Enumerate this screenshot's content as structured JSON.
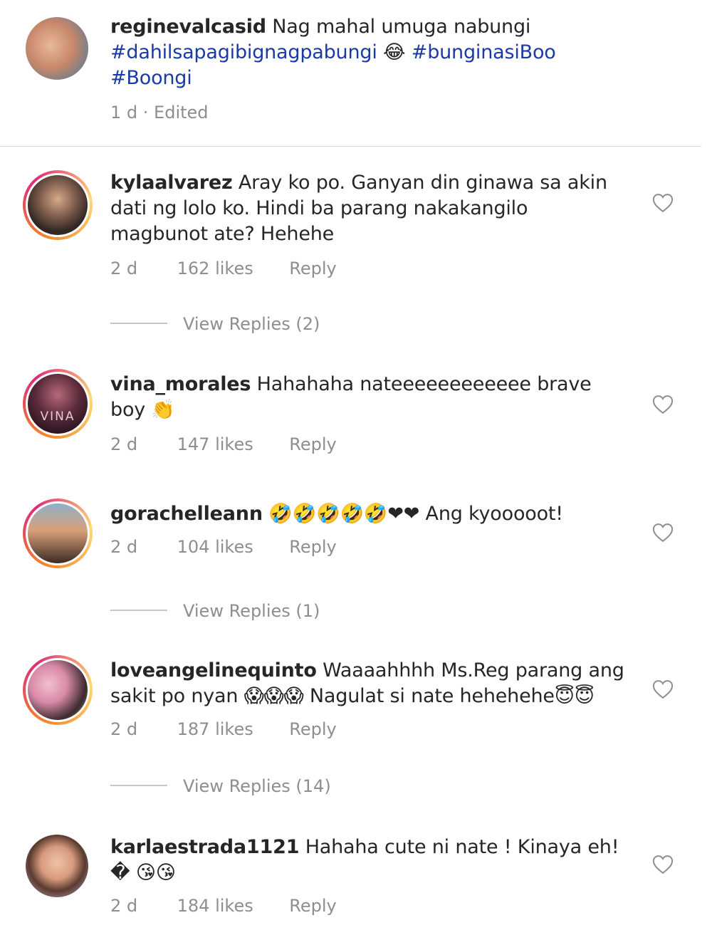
{
  "caption": {
    "username": "reginevalcasid",
    "text": "Nag mahal umuga nabungi",
    "hashtags": [
      "#dahilsapagibignagpabungi",
      "#bunginasiBoo",
      "#Boongi"
    ],
    "emoji": "😂",
    "time": "1 d",
    "edited": "· Edited"
  },
  "comments": [
    {
      "username": "kylaalvarez",
      "text": "Aray ko po. Ganyan din ginawa sa akin dati ng lolo ko. Hindi ba parang nakakangilo magbunot ate? Hehehe",
      "time": "2 d",
      "likes": "162 likes",
      "reply": "Reply",
      "view_replies": "View Replies (2)"
    },
    {
      "username": "vina_morales",
      "text": "Hahahaha nateeeeeeeeeeee brave boy 👏",
      "time": "2 d",
      "likes": "147 likes",
      "reply": "Reply",
      "avatar_text": "VINA"
    },
    {
      "username": "gorachelleann",
      "text": "🤣🤣🤣🤣🤣❤❤ Ang kyooooot!",
      "time": "2 d",
      "likes": "104 likes",
      "reply": "Reply",
      "view_replies": "View Replies (1)"
    },
    {
      "username": "loveangelinequinto",
      "text": "Waaaahhhh Ms.Reg parang ang sakit po nyan 😱😱😱 Nagulat si nate hehehehe😇😇",
      "time": "2 d",
      "likes": "187 likes",
      "reply": "Reply",
      "view_replies": "View Replies (14)"
    },
    {
      "username": "karlaestrada1121",
      "text": "Hahaha cute ni nate ! Kinaya eh!� 😘😘",
      "time": "2 d",
      "likes": "184 likes",
      "reply": "Reply"
    }
  ],
  "icons": {
    "like": "heart-outline-icon"
  },
  "colors": {
    "hashtag": "#1a3aa5",
    "meta": "#8e8e8e",
    "heart_stroke": "#8e8e8e"
  }
}
